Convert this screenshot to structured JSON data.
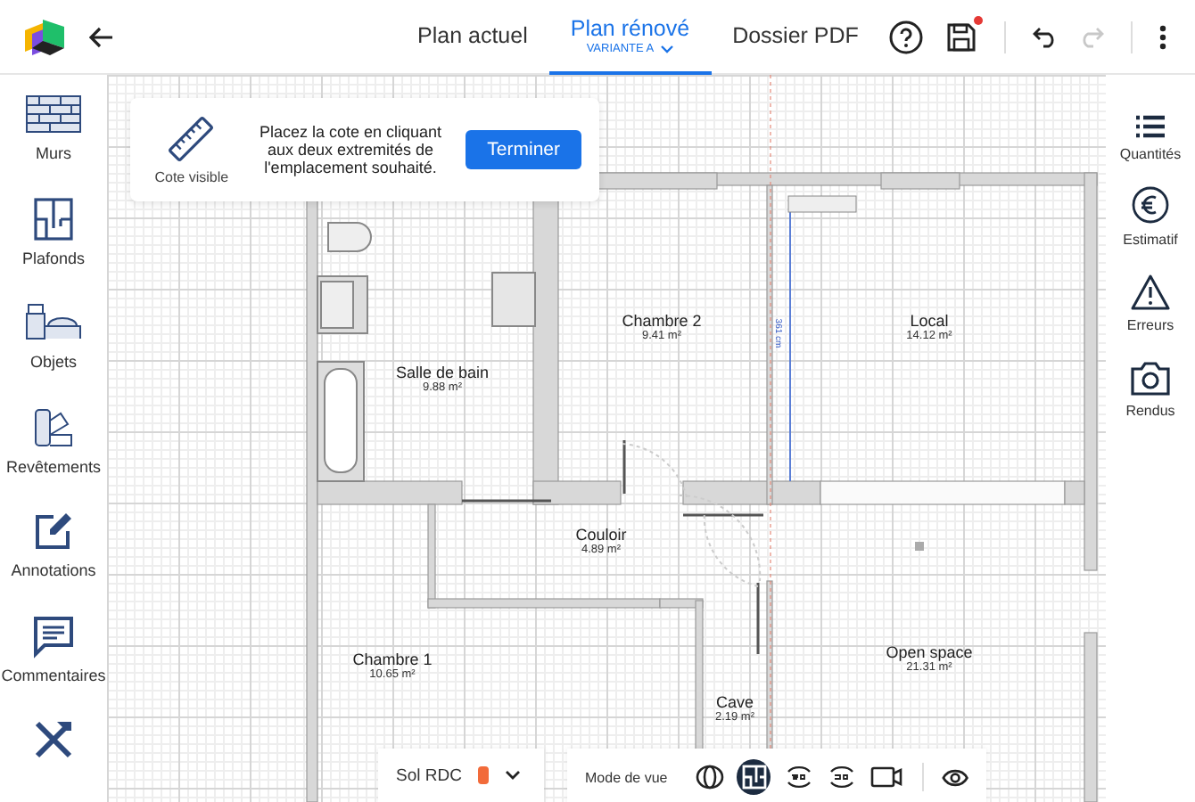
{
  "header": {
    "tabs": [
      {
        "label": "Plan actuel",
        "selected": false
      },
      {
        "label": "Plan rénové",
        "selected": true,
        "variant": "VARIANTE A"
      },
      {
        "label": "Dossier PDF",
        "selected": false
      }
    ],
    "unsaved": true,
    "redo_disabled": true
  },
  "left_sidebar": {
    "items": [
      {
        "kind": "walls",
        "label": "Murs"
      },
      {
        "kind": "ceilings",
        "label": "Plafonds"
      },
      {
        "kind": "objects",
        "label": "Objets"
      },
      {
        "kind": "coverings",
        "label": "Revêtements"
      },
      {
        "kind": "annotations",
        "label": "Annotations"
      },
      {
        "kind": "comments",
        "label": "Commentaires"
      },
      {
        "kind": "tools"
      }
    ]
  },
  "right_sidebar": {
    "items": [
      {
        "kind": "quantities",
        "label": "Quantités"
      },
      {
        "kind": "estimate",
        "label": "Estimatif"
      },
      {
        "kind": "errors",
        "label": "Erreurs"
      },
      {
        "kind": "renders",
        "label": "Rendus"
      }
    ]
  },
  "hint_card": {
    "tool_label": "Cote visible",
    "message": "Placez la cote en cliquant aux deux extremités de l'emplacement souhaité.",
    "button": "Terminer"
  },
  "plan": {
    "rooms": [
      {
        "name": "Salle de bain",
        "area": "9.88 m²"
      },
      {
        "name": "Chambre 2",
        "area": "9.41 m²"
      },
      {
        "name": "Local",
        "area": "14.12 m²"
      },
      {
        "name": "Couloir",
        "area": "4.89 m²"
      },
      {
        "name": "Chambre 1",
        "area": "10.65 m²"
      },
      {
        "name": "Cave",
        "area": "2.19 m²"
      },
      {
        "name": "Open space",
        "area": "21.31 m²"
      }
    ],
    "dimension": "361 cm"
  },
  "floor_selector": {
    "label": "Sol RDC",
    "color": "#f26b3a"
  },
  "view_toolbar": {
    "label": "Mode de vue",
    "modes": [
      {
        "kind": "sphere",
        "selected": false
      },
      {
        "kind": "plan",
        "selected": true
      },
      {
        "kind": "rotate-2d",
        "selected": false
      },
      {
        "kind": "rotate-3d",
        "selected": false
      },
      {
        "kind": "video",
        "selected": false
      }
    ]
  }
}
